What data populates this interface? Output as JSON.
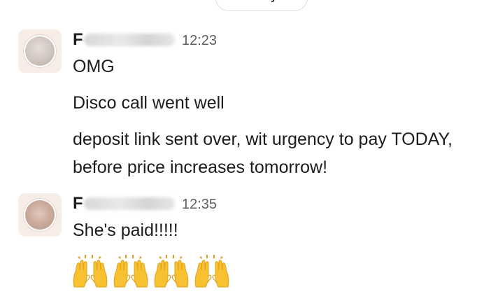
{
  "day_divider": {
    "label": "Today"
  },
  "messages": [
    {
      "sender_initial": "F",
      "time": "12:23",
      "lines": [
        "OMG",
        "Disco call went well",
        "deposit link sent over, wit urgency to pay TODAY,",
        "before price increases tomorrow!"
      ]
    },
    {
      "sender_initial": "F",
      "time": "12:35",
      "lines": [
        "She's paid!!!!!"
      ],
      "emoji": [
        "raised-hands-icon",
        "raised-hands-icon",
        "raised-hands-icon",
        "raised-hands-icon"
      ]
    }
  ],
  "colors": {
    "text": "#1d1c1d",
    "timestamp": "#616061",
    "emoji_yellow": "#f7c132"
  }
}
